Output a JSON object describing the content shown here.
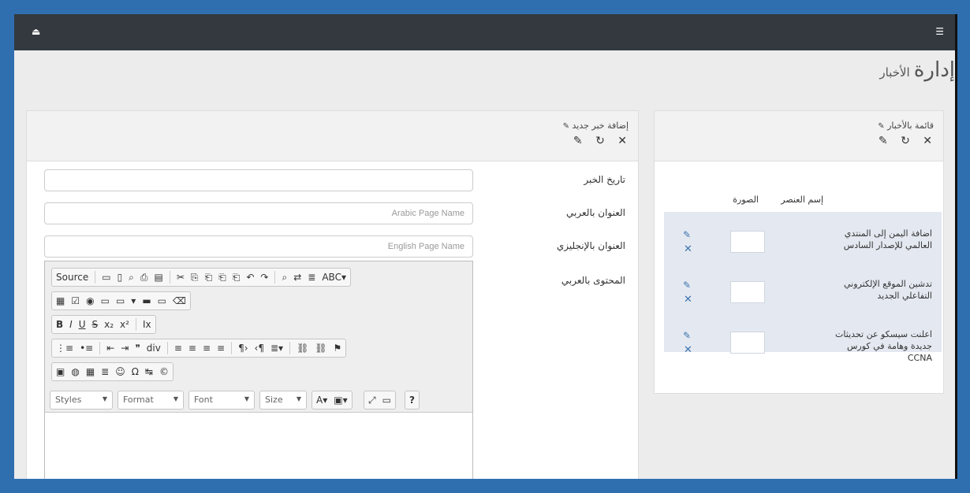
{
  "topbar": {
    "left_icon": "sign-out-icon",
    "left_glyph": "⏏",
    "right_icon": "menu-icon",
    "right_glyph": "☰"
  },
  "page": {
    "title": "إدارة",
    "subtitle": "الأخبار"
  },
  "list_panel": {
    "title": "قائمة بالأخبار",
    "edit_glyph": "✎",
    "tools": [
      "✕",
      "↻",
      "✎"
    ],
    "columns": [
      "إسم العنصر",
      "الصورة"
    ],
    "rows": [
      {
        "title": "اضافة اليمن إلى المنتدي العالمي للإصدار السادس",
        "edit": "✎",
        "delete": "✕",
        "thumb_icon": "image-thumb-icon"
      },
      {
        "title": "تدشين الموقع الإلكتروني التفاعلي الجديد",
        "edit": "✎",
        "delete": "✕",
        "thumb_icon": "image-thumb-icon"
      },
      {
        "title": "اعلنت سيسكو عن تحديثات جديدة وهامة في كورس CCNA",
        "edit": "✎",
        "delete": "✕",
        "thumb_icon": "image-thumb-icon"
      }
    ]
  },
  "form_panel": {
    "title": "إضافة خبر جديد",
    "edit_glyph": "✎",
    "tools": [
      "✕",
      "↻",
      "✎"
    ],
    "fields": {
      "date_label": "تاريخ الخبر",
      "date_value": "",
      "ar_title_label": "العنوان بالعربي",
      "ar_title_placeholder": "Arabic Page Name",
      "en_title_label": "العنوان بالإنجليزي",
      "en_title_placeholder": "English Page Name",
      "ar_content_label": "المحتوى بالعربي"
    },
    "editor": {
      "source_label": "Source",
      "row1_glyphs": [
        "▭",
        "▯",
        "⌕",
        "⎙",
        "▤",
        "✂",
        "⎘",
        "⎗",
        "⎗",
        "⎗",
        "↶",
        "↷",
        "⌕",
        "⇄",
        "≣",
        "ABC▾"
      ],
      "row2_glyphs": [
        "▦",
        "☑",
        "◉",
        "▭",
        "▭",
        "▾",
        "▬",
        "▭",
        "⌫"
      ],
      "row3_glyphs": [
        "B",
        "I",
        "U",
        "S",
        "x₂",
        "x²",
        "Ix"
      ],
      "row4_glyphs": [
        "⋮≡",
        "•≡",
        "⇤",
        "⇥",
        "❞",
        "div",
        "≡",
        "≡",
        "≡",
        "≡",
        "¶›",
        "‹¶",
        "≣▾",
        "⛓",
        "⛓",
        "⚑"
      ],
      "row5_glyphs": [
        "▣",
        "◍",
        "▦",
        "≣",
        "☺",
        "Ω",
        "↹",
        "©"
      ],
      "styles": "Styles",
      "format": "Format",
      "font": "Font",
      "size": "Size",
      "extra_glyphs": [
        "A▾",
        "▣▾",
        "⤢",
        "▭",
        "?"
      ]
    }
  }
}
